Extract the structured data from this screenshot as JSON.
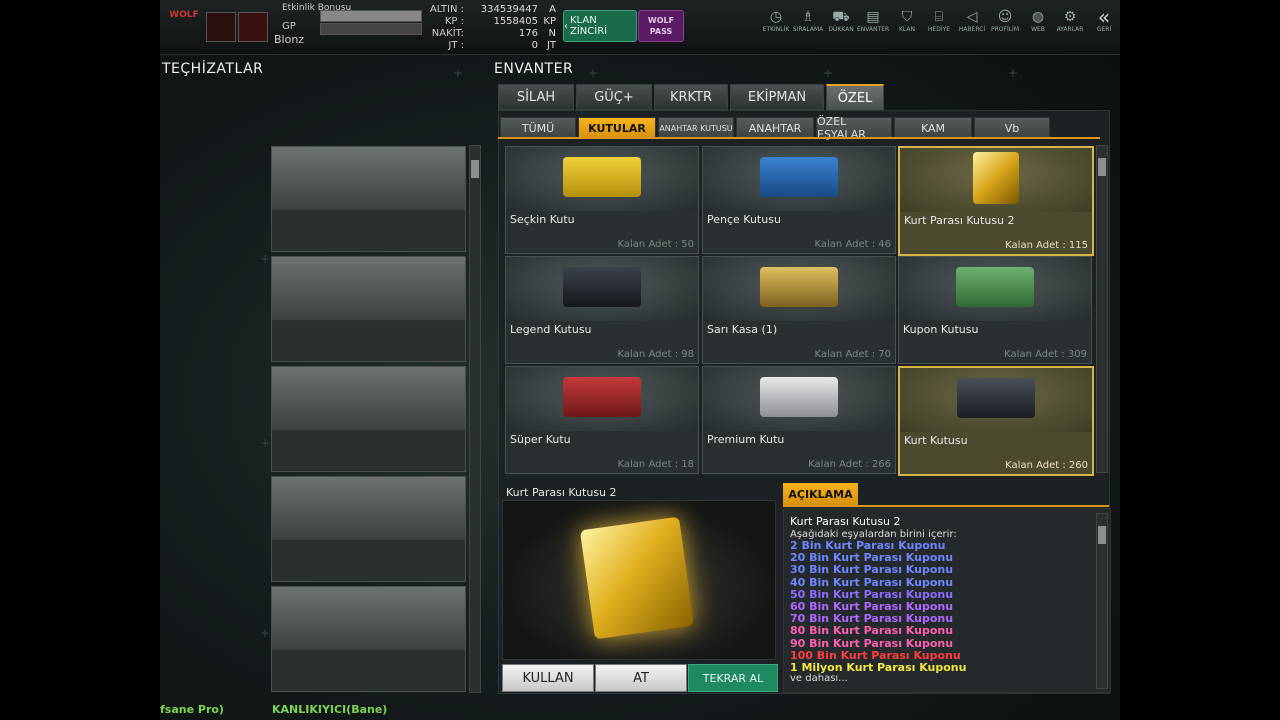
{
  "topbar": {
    "logo_text": "WOLF",
    "event_bonus_label": "Etkinlik Bonusu",
    "gp_label": "GP",
    "username": "Blonz",
    "currency": [
      {
        "key": "ALTIN :",
        "value": "334539447",
        "unit": "A"
      },
      {
        "key": "KP :",
        "value": "1558405",
        "unit": "KP"
      },
      {
        "key": "NAKİT:",
        "value": "176",
        "unit": "N"
      },
      {
        "key": "JT :",
        "value": "0",
        "unit": "JT"
      }
    ],
    "klan_button": "KLAN ZİNCİRİ",
    "wolf_pass": "WOLF PASS",
    "nav": [
      {
        "label": "ETKİNLİK",
        "icon": "clock-icon"
      },
      {
        "label": "SIRALAMA",
        "icon": "medal-icon"
      },
      {
        "label": "DÜKKAN",
        "icon": "cart-icon"
      },
      {
        "label": "ENVANTER",
        "icon": "inventory-icon"
      },
      {
        "label": "KLAN",
        "icon": "shield-icon"
      },
      {
        "label": "HEDİYE",
        "icon": "gift-icon"
      },
      {
        "label": "HABERCİ",
        "icon": "megaphone-icon"
      },
      {
        "label": "PROFİLİM",
        "icon": "profile-icon"
      },
      {
        "label": "WEB",
        "icon": "globe-icon"
      },
      {
        "label": "AYARLAR",
        "icon": "gear-icon"
      },
      {
        "label": "GERİ",
        "icon": "back-icon"
      }
    ]
  },
  "equipment": {
    "title": "TEÇHİZATLAR"
  },
  "inventory": {
    "title": "ENVANTER",
    "tabs": [
      "SİLAH",
      "GÜÇ+",
      "KRKTR",
      "EKİPMAN",
      "ÖZEL"
    ],
    "active_tab": "ÖZEL",
    "subtabs": [
      "TÜMÜ",
      "KUTULAR",
      "ANAHTAR KUTUSU",
      "ANAHTAR",
      "ÖZEL EŞYALAR",
      "KAM",
      "Vb"
    ],
    "active_subtab": "KUTULAR",
    "count_prefix": "Kalan Adet :",
    "items": [
      {
        "name": "Seçkin Kutu",
        "count": "50"
      },
      {
        "name": "Pençe Kutusu",
        "count": "46"
      },
      {
        "name": "Kurt Parası Kutusu 2",
        "count": "115"
      },
      {
        "name": "Legend Kutusu",
        "count": "98"
      },
      {
        "name": "Sarı Kasa (1)",
        "count": "70"
      },
      {
        "name": "Kupon Kutusu",
        "count": "309"
      },
      {
        "name": "Süper Kutu",
        "count": "18"
      },
      {
        "name": "Premium Kutu",
        "count": "266"
      },
      {
        "name": "Kurt Kutusu",
        "count": "260"
      }
    ],
    "colors": {
      "accent": "#f6b41c",
      "selected_border": "#d6b446"
    }
  },
  "detail": {
    "title": "Kurt Parası Kutusu 2",
    "buttons": {
      "use": "KULLAN",
      "drop": "AT",
      "retake": "TEKRAR AL"
    }
  },
  "description": {
    "tab": "AÇIKLAMA",
    "title": "Kurt Parası Kutusu 2",
    "subtitle": "Aşağıdaki eşyalardan birini içerir:",
    "entries": [
      {
        "text": "2 Bin Kurt Parası Kuponu",
        "color": "#6f86ff"
      },
      {
        "text": "20 Bin Kurt Parası Kuponu",
        "color": "#6f86ff"
      },
      {
        "text": "30 Bin Kurt Parası Kuponu",
        "color": "#6f86ff"
      },
      {
        "text": "40 Bin Kurt Parası Kuponu",
        "color": "#6f86ff"
      },
      {
        "text": "50 Bin Kurt Parası Kuponu",
        "color": "#8b6dff"
      },
      {
        "text": "60 Bin Kurt Parası Kuponu",
        "color": "#b066ff"
      },
      {
        "text": "70 Bin Kurt Parası Kuponu",
        "color": "#b066ff"
      },
      {
        "text": "80 Bin Kurt Parası Kuponu",
        "color": "#ff5fb0"
      },
      {
        "text": "90 Bin Kurt Parası Kuponu",
        "color": "#ff5fb0"
      },
      {
        "text": "100 Bin Kurt Parası Kuponu",
        "color": "#ff3b3b"
      },
      {
        "text": "1 Milyon Kurt Parası Kuponu",
        "color": "#f5e642"
      }
    ],
    "more": "ve dahası..."
  },
  "chat": {
    "left": "fsane Pro)",
    "mid": "KANLIKIYICI(Bane)"
  }
}
